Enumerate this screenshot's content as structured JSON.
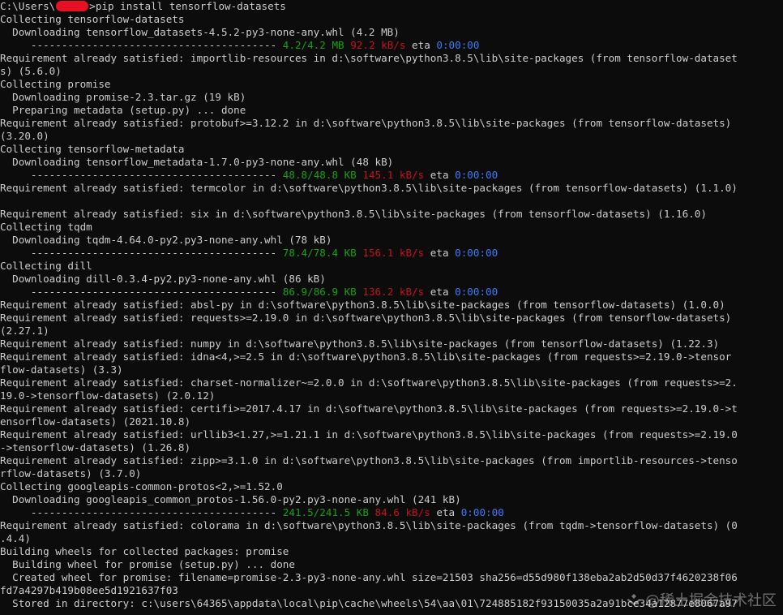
{
  "console": {
    "lines": [
      [
        {
          "t": "C:\\Users\\"
        },
        {
          "t": "",
          "redact": true
        },
        {
          "t": ">pip install tensorflow-datasets"
        }
      ],
      [
        {
          "t": "Collecting tensorflow-datasets"
        }
      ],
      [
        {
          "t": "  Downloading tensorflow_datasets-4.5.2-py3-none-any.whl (4.2 MB)"
        }
      ],
      [
        {
          "t": "     ---------------------------------------- "
        },
        {
          "t": "4.2/4.2 MB",
          "c": "green"
        },
        {
          "t": " "
        },
        {
          "t": "92.2 kB/s",
          "c": "red"
        },
        {
          "t": " eta "
        },
        {
          "t": "0:00:00",
          "c": "blue"
        }
      ],
      [
        {
          "t": "Requirement already satisfied: importlib-resources in d:\\software\\python3.8.5\\lib\\site-packages (from tensorflow-dataset"
        }
      ],
      [
        {
          "t": "s) (5.6.0)"
        }
      ],
      [
        {
          "t": "Collecting promise"
        }
      ],
      [
        {
          "t": "  Downloading promise-2.3.tar.gz (19 kB)"
        }
      ],
      [
        {
          "t": "  Preparing metadata (setup.py) ... done"
        }
      ],
      [
        {
          "t": "Requirement already satisfied: protobuf>=3.12.2 in d:\\software\\python3.8.5\\lib\\site-packages (from tensorflow-datasets)"
        }
      ],
      [
        {
          "t": "(3.20.0)"
        }
      ],
      [
        {
          "t": "Collecting tensorflow-metadata"
        }
      ],
      [
        {
          "t": "  Downloading tensorflow_metadata-1.7.0-py3-none-any.whl (48 kB)"
        }
      ],
      [
        {
          "t": "     ---------------------------------------- "
        },
        {
          "t": "48.8/48.8 KB",
          "c": "green"
        },
        {
          "t": " "
        },
        {
          "t": "145.1 kB/s",
          "c": "red"
        },
        {
          "t": " eta "
        },
        {
          "t": "0:00:00",
          "c": "blue"
        }
      ],
      [
        {
          "t": "Requirement already satisfied: termcolor in d:\\software\\python3.8.5\\lib\\site-packages (from tensorflow-datasets) (1.1.0)"
        }
      ],
      [
        {
          "t": ""
        }
      ],
      [
        {
          "t": "Requirement already satisfied: six in d:\\software\\python3.8.5\\lib\\site-packages (from tensorflow-datasets) (1.16.0)"
        }
      ],
      [
        {
          "t": "Collecting tqdm"
        }
      ],
      [
        {
          "t": "  Downloading tqdm-4.64.0-py2.py3-none-any.whl (78 kB)"
        }
      ],
      [
        {
          "t": "     ---------------------------------------- "
        },
        {
          "t": "78.4/78.4 KB",
          "c": "green"
        },
        {
          "t": " "
        },
        {
          "t": "156.1 kB/s",
          "c": "red"
        },
        {
          "t": " eta "
        },
        {
          "t": "0:00:00",
          "c": "blue"
        }
      ],
      [
        {
          "t": "Collecting dill"
        }
      ],
      [
        {
          "t": "  Downloading dill-0.3.4-py2.py3-none-any.whl (86 kB)"
        }
      ],
      [
        {
          "t": "     ---------------------------------------- "
        },
        {
          "t": "86.9/86.9 KB",
          "c": "green"
        },
        {
          "t": " "
        },
        {
          "t": "136.2 kB/s",
          "c": "red"
        },
        {
          "t": " eta "
        },
        {
          "t": "0:00:00",
          "c": "blue"
        }
      ],
      [
        {
          "t": "Requirement already satisfied: absl-py in d:\\software\\python3.8.5\\lib\\site-packages (from tensorflow-datasets) (1.0.0)"
        }
      ],
      [
        {
          "t": "Requirement already satisfied: requests>=2.19.0 in d:\\software\\python3.8.5\\lib\\site-packages (from tensorflow-datasets)"
        }
      ],
      [
        {
          "t": "(2.27.1)"
        }
      ],
      [
        {
          "t": "Requirement already satisfied: numpy in d:\\software\\python3.8.5\\lib\\site-packages (from tensorflow-datasets) (1.22.3)"
        }
      ],
      [
        {
          "t": "Requirement already satisfied: idna<4,>=2.5 in d:\\software\\python3.8.5\\lib\\site-packages (from requests>=2.19.0->tensor"
        }
      ],
      [
        {
          "t": "flow-datasets) (3.3)"
        }
      ],
      [
        {
          "t": "Requirement already satisfied: charset-normalizer~=2.0.0 in d:\\software\\python3.8.5\\lib\\site-packages (from requests>=2."
        }
      ],
      [
        {
          "t": "19.0->tensorflow-datasets) (2.0.12)"
        }
      ],
      [
        {
          "t": "Requirement already satisfied: certifi>=2017.4.17 in d:\\software\\python3.8.5\\lib\\site-packages (from requests>=2.19.0->t"
        }
      ],
      [
        {
          "t": "ensorflow-datasets) (2021.10.8)"
        }
      ],
      [
        {
          "t": "Requirement already satisfied: urllib3<1.27,>=1.21.1 in d:\\software\\python3.8.5\\lib\\site-packages (from requests>=2.19.0"
        }
      ],
      [
        {
          "t": "->tensorflow-datasets) (1.26.8)"
        }
      ],
      [
        {
          "t": "Requirement already satisfied: zipp>=3.1.0 in d:\\software\\python3.8.5\\lib\\site-packages (from importlib-resources->tenso"
        }
      ],
      [
        {
          "t": "rflow-datasets) (3.7.0)"
        }
      ],
      [
        {
          "t": "Collecting googleapis-common-protos<2,>=1.52.0"
        }
      ],
      [
        {
          "t": "  Downloading googleapis_common_protos-1.56.0-py2.py3-none-any.whl (241 kB)"
        }
      ],
      [
        {
          "t": "     ---------------------------------------- "
        },
        {
          "t": "241.5/241.5 KB",
          "c": "green"
        },
        {
          "t": " "
        },
        {
          "t": "84.6 kB/s",
          "c": "red"
        },
        {
          "t": " eta "
        },
        {
          "t": "0:00:00",
          "c": "blue"
        }
      ],
      [
        {
          "t": "Requirement already satisfied: colorama in d:\\software\\python3.8.5\\lib\\site-packages (from tqdm->tensorflow-datasets) (0"
        }
      ],
      [
        {
          "t": ".4.4)"
        }
      ],
      [
        {
          "t": "Building wheels for collected packages: promise"
        }
      ],
      [
        {
          "t": "  Building wheel for promise (setup.py) ... done"
        }
      ],
      [
        {
          "t": "  Created wheel for promise: filename=promise-2.3-py3-none-any.whl size=21503 sha256=d55d980f138eba2ab2d50d37f4620238f06"
        }
      ],
      [
        {
          "t": "fd7a4297b419b08ee5d1921637f03"
        }
      ],
      [
        {
          "t": "  Stored in directory: c:\\users\\64365\\appdata\\local\\pip\\cache\\wheels\\54\\aa\\01\\724885182f93150035a2a91bce34a12877e8067a97"
        }
      ]
    ]
  },
  "watermark": {
    "text": "@稀土掘金技术社区",
    "icon": "juejin-logo-icon"
  },
  "colors": {
    "background": "#0c0c0c",
    "text": "#cccccc",
    "green": "#13a10e",
    "red": "#c50f1f",
    "blue": "#3b78ff",
    "redaction": "#e81123"
  }
}
